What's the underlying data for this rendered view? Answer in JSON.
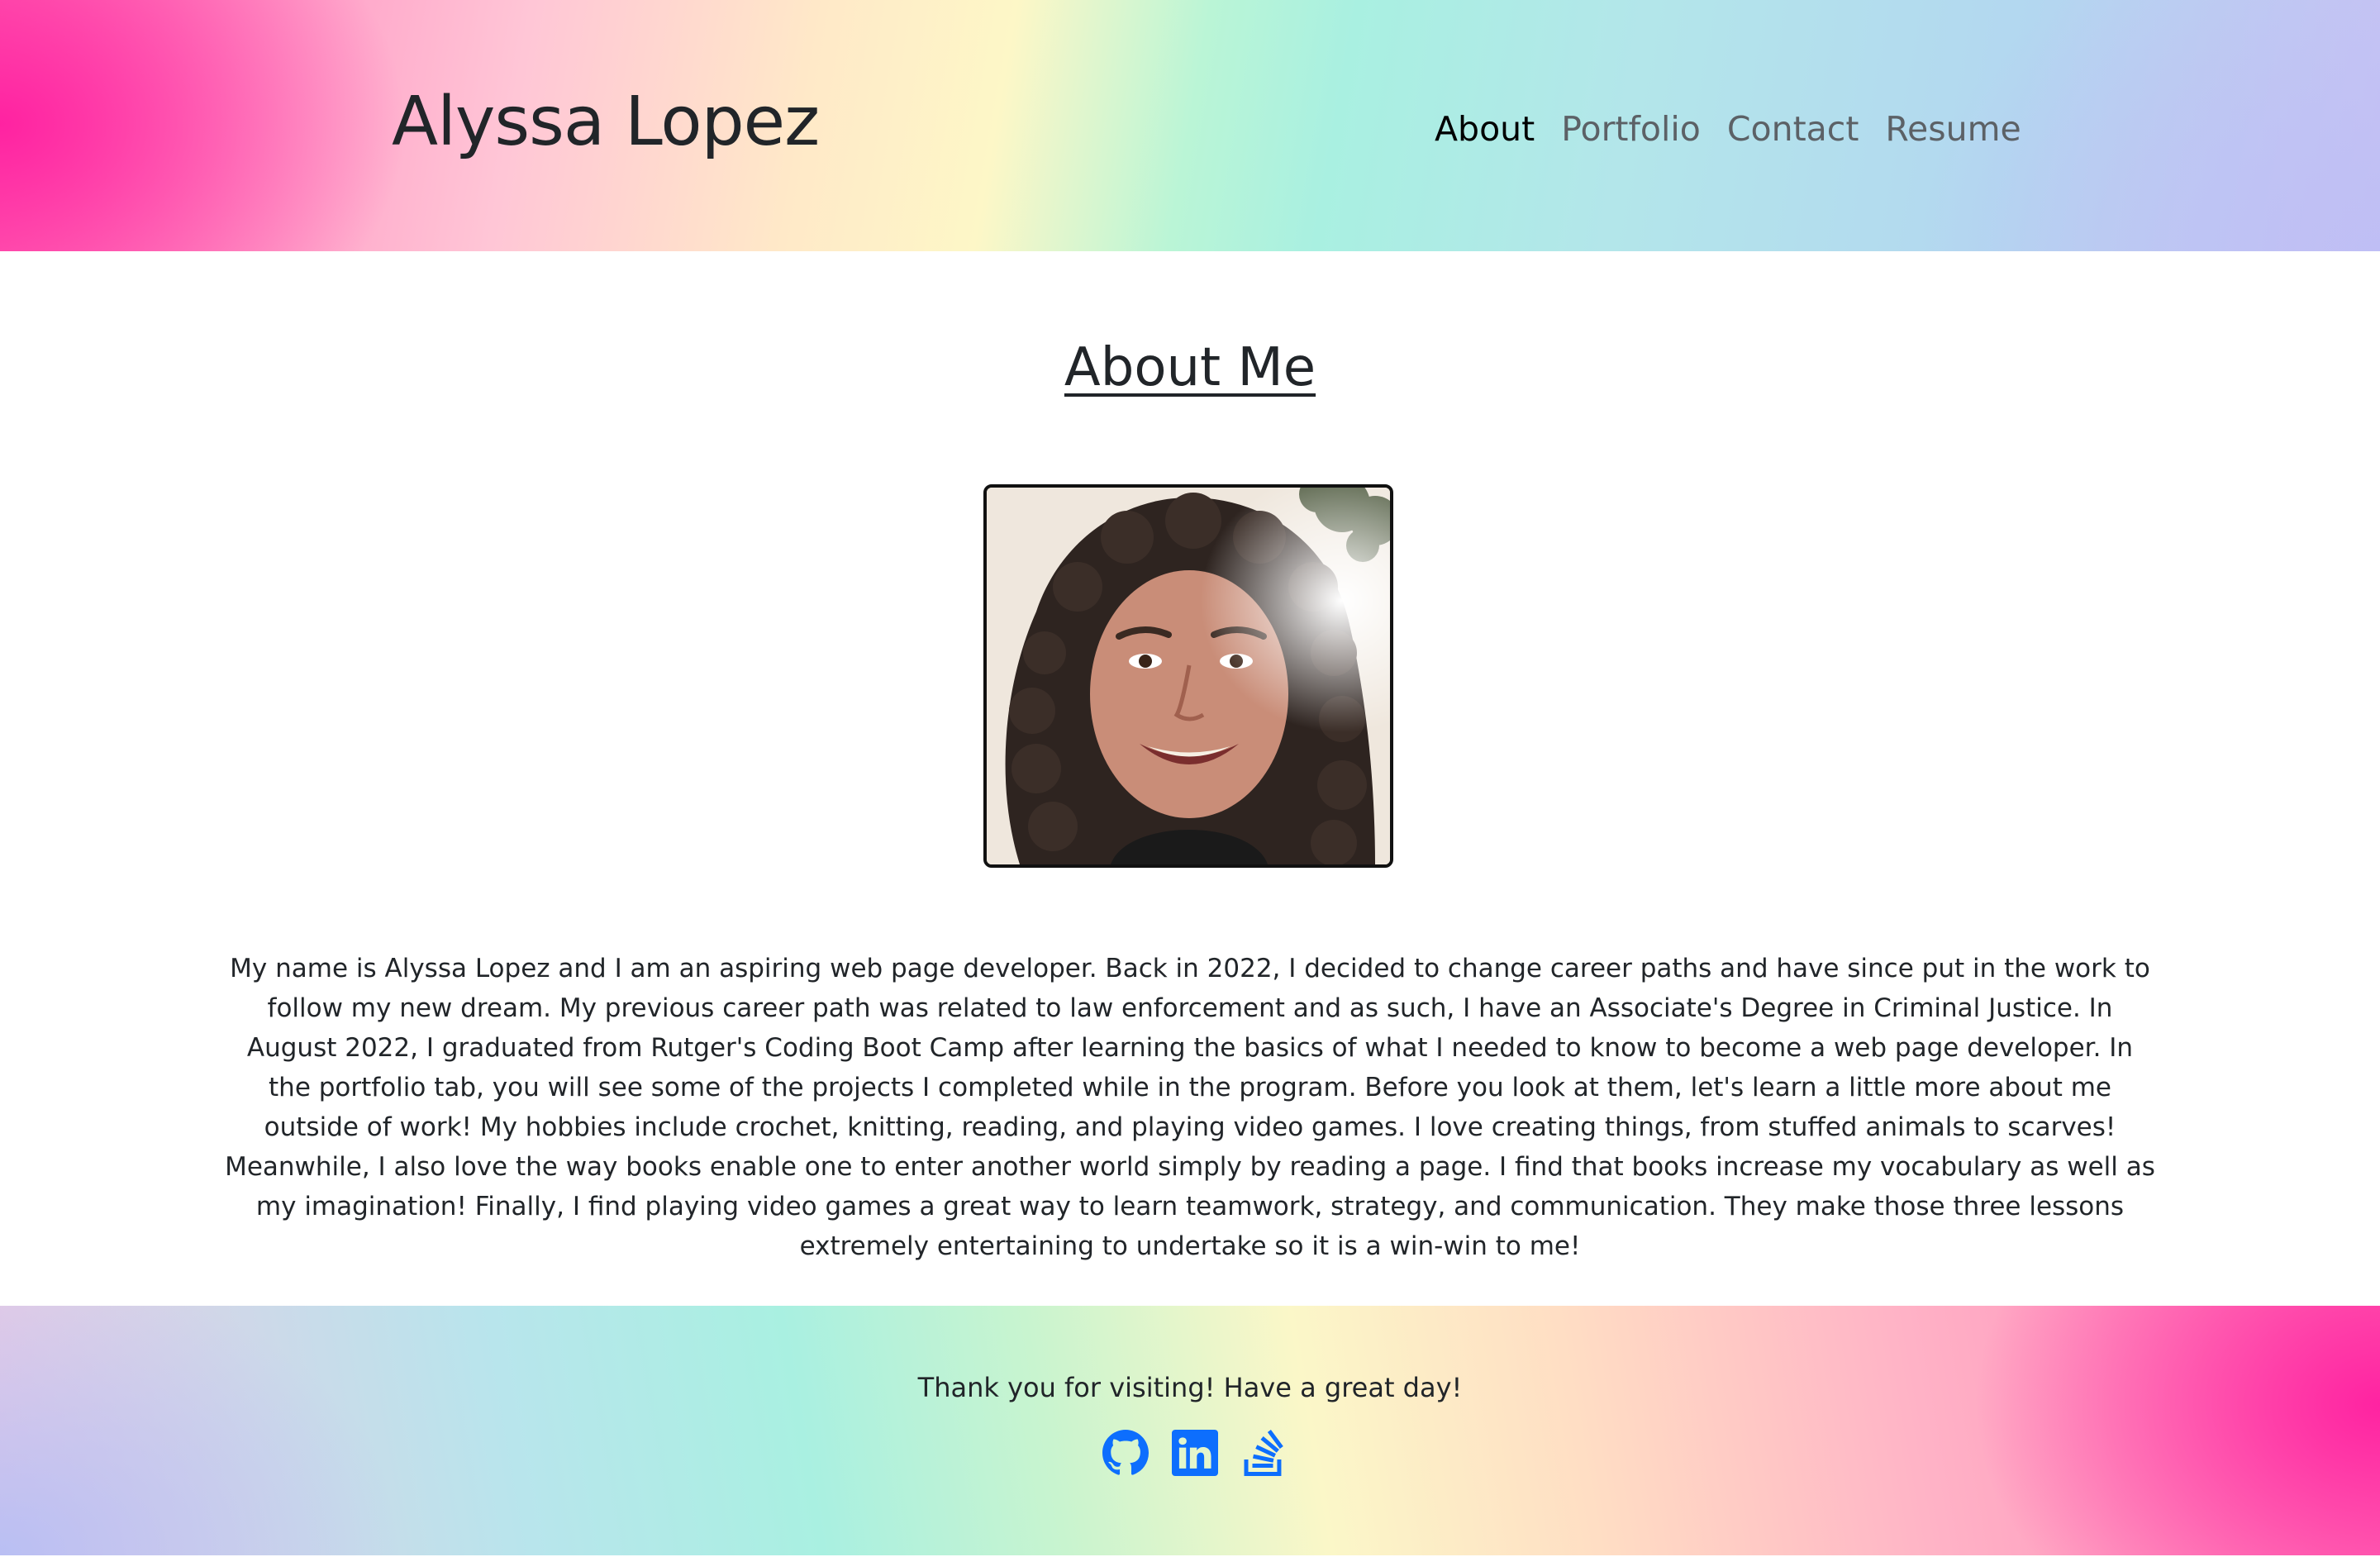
{
  "header": {
    "brand": "Alyssa Lopez",
    "nav": [
      {
        "label": "About",
        "active": true
      },
      {
        "label": "Portfolio",
        "active": false
      },
      {
        "label": "Contact",
        "active": false
      },
      {
        "label": "Resume",
        "active": false
      }
    ]
  },
  "main": {
    "title": "About Me",
    "photo_icon": "profile-photo",
    "bio": "My name is Alyssa Lopez and I am an aspiring web page developer. Back in 2022, I decided to change career paths and have since put in the work to follow my new dream. My previous career path was related to law enforcement and as such, I have an Associate's Degree in Criminal Justice. In August 2022, I graduated from Rutger's Coding Boot Camp after learning the basics of what I needed to know to become a web page developer. In the portfolio tab, you will see some of the projects I completed while in the program. Before you look at them, let's learn a little more about me outside of work! My hobbies include crochet, knitting, reading, and playing video games. I love creating things, from stuffed animals to scarves! Meanwhile, I also love the way books enable one to enter another world simply by reading a page. I find that books increase my vocabulary as well as my imagination! Finally, I find playing video games a great way to learn teamwork, strategy, and communication. They make those three lessons extremely entertaining to undertake so it is a win-win to me!"
  },
  "footer": {
    "text": "Thank you for visiting! Have a great day!",
    "socials": [
      "github-icon",
      "linkedin-icon",
      "stackoverflow-icon"
    ]
  },
  "colors": {
    "icon_blue": "#0d6efd",
    "text_dark": "#212529",
    "nav_muted": "#5c6166"
  }
}
